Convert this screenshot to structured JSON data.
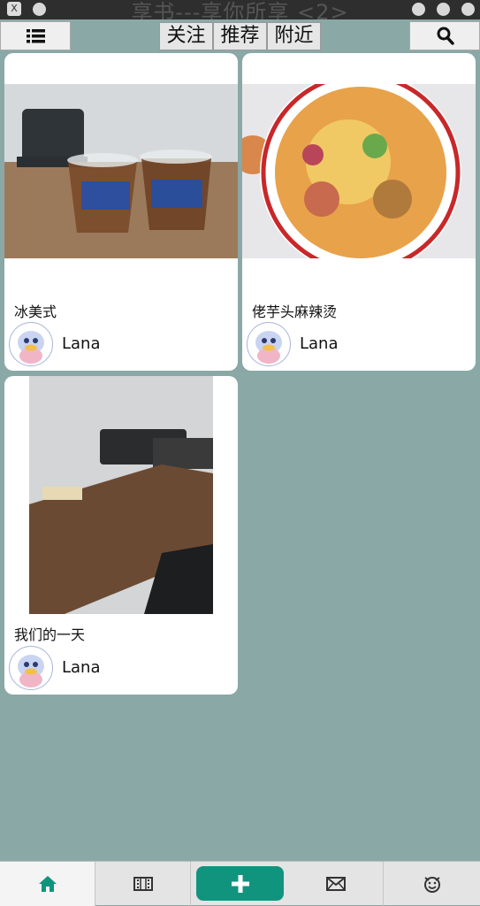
{
  "window": {
    "title": "享书---享你所享 <2>"
  },
  "toolbar": {
    "tabs": [
      {
        "label": "关注"
      },
      {
        "label": "推荐"
      },
      {
        "label": "附近"
      }
    ]
  },
  "feed": {
    "cards": [
      {
        "title": "冰美式",
        "user": "Lana"
      },
      {
        "title": "佬芋头麻辣烫",
        "user": "Lana"
      },
      {
        "title": "我们的一天",
        "user": "Lana"
      }
    ]
  },
  "bottom_nav": {
    "items": [
      {
        "icon": "home-icon"
      },
      {
        "icon": "film-icon"
      },
      {
        "icon": "plus-icon"
      },
      {
        "icon": "mail-icon"
      },
      {
        "icon": "smiley-icon"
      }
    ]
  },
  "colors": {
    "background": "#8aa8a6",
    "accent": "#11947e"
  }
}
